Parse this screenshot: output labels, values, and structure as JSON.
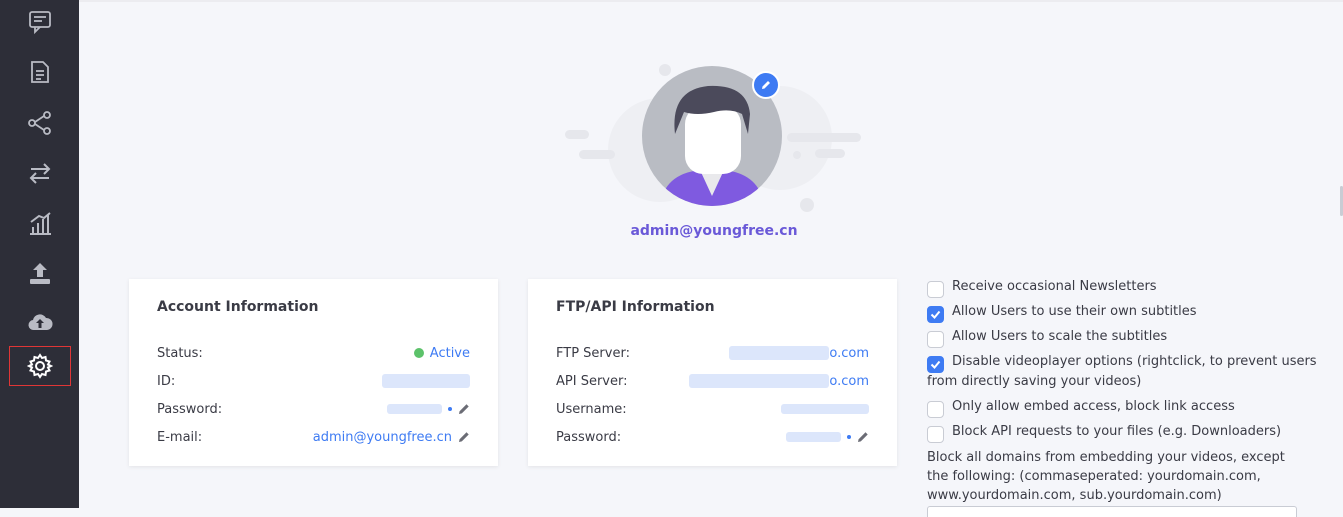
{
  "sidebar": {
    "items": [
      {
        "icon": "chat-icon",
        "active": false
      },
      {
        "icon": "document-icon",
        "active": false
      },
      {
        "icon": "share-icon",
        "active": false
      },
      {
        "icon": "transfer-icon",
        "active": false
      },
      {
        "icon": "stats-icon",
        "active": false
      },
      {
        "icon": "upload-icon",
        "active": false
      },
      {
        "icon": "cloud-upload-icon",
        "active": false
      },
      {
        "icon": "gear-icon",
        "active": true
      }
    ]
  },
  "profile": {
    "email": "admin@youngfree.cn"
  },
  "account": {
    "title": "Account Information",
    "status_label": "Status:",
    "status_value": "Active",
    "id_label": "ID:",
    "password_label": "Password:",
    "email_label": "E-mail:",
    "email_value": "admin@youngfree.cn"
  },
  "ftp": {
    "title": "FTP/API Information",
    "ftp_server_label": "FTP Server:",
    "ftp_server_value": "o.com",
    "api_server_label": "API Server:",
    "api_server_value": "o.com",
    "username_label": "Username:",
    "password_label": "Password:"
  },
  "options": {
    "items": [
      {
        "label": "Receive occasional Newsletters",
        "checked": false
      },
      {
        "label": "Allow Users to use their own subtitles",
        "checked": true
      },
      {
        "label": "Allow Users to scale the subtitles",
        "checked": false
      },
      {
        "label": "Disable videoplayer options (rightclick, to prevent users",
        "label2": "from directly saving your videos)",
        "checked": true
      },
      {
        "label": "Only allow embed access, block link access",
        "checked": false
      },
      {
        "label": "Block API requests to your files (e.g. Downloaders)",
        "checked": false
      }
    ],
    "block_domains_text": "Block all domains from embedding your videos, except the following: (commaseperated: yourdomain.com, www.yourdomain.com, sub.yourdomain.com)"
  },
  "colors": {
    "accent": "#3e7bf3",
    "brand_purple": "#6a59d8",
    "status_active": "#5cc26a",
    "sidebar_bg": "#2d2e38",
    "active_border": "#e03636"
  }
}
